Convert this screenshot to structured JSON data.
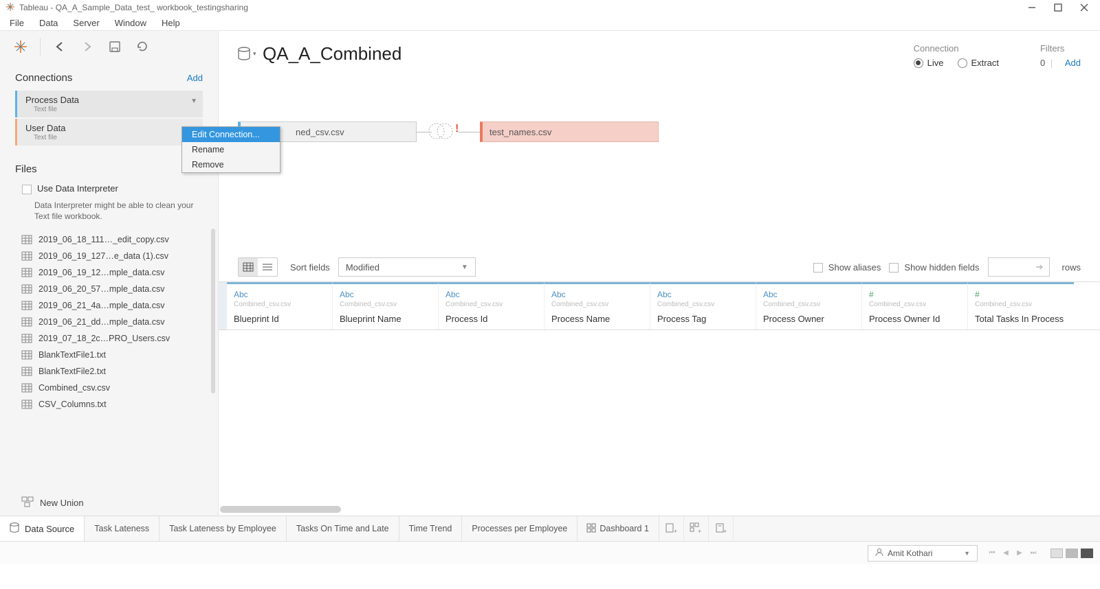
{
  "window": {
    "title": "Tableau - QA_A_Sample_Data_test_ workbook_testingsharing"
  },
  "menu": {
    "items": [
      "File",
      "Data",
      "Server",
      "Window",
      "Help"
    ]
  },
  "sidebar": {
    "connections_label": "Connections",
    "add_label": "Add",
    "connections": [
      {
        "name": "Process Data",
        "type": "Text file"
      },
      {
        "name": "User Data",
        "type": "Text file"
      }
    ],
    "files_label": "Files",
    "interpreter_label": "Use Data Interpreter",
    "interpreter_help": "Data Interpreter might be able to clean your Text file workbook.",
    "files": [
      "2019_06_18_111…_edit_copy.csv",
      "2019_06_19_127…e_data (1).csv",
      "2019_06_19_12…mple_data.csv",
      "2019_06_20_57…mple_data.csv",
      "2019_06_21_4a…mple_data.csv",
      "2019_06_21_dd…mple_data.csv",
      "2019_07_18_2c…PRO_Users.csv",
      "BlankTextFile1.txt",
      "BlankTextFile2.txt",
      "Combined_csv.csv",
      "CSV_Columns.txt"
    ],
    "new_union": "New Union"
  },
  "context_menu": {
    "items": [
      "Edit Connection...",
      "Rename",
      "Remove"
    ]
  },
  "datasource": {
    "title": "QA_A_Combined",
    "connection_label": "Connection",
    "live": "Live",
    "extract": "Extract",
    "filters_label": "Filters",
    "filters_count": "0",
    "filters_add": "Add"
  },
  "canvas": {
    "left_table": "ned_csv.csv",
    "right_table": "test_names.csv"
  },
  "grid": {
    "sort_label": "Sort fields",
    "sort_value": "Modified",
    "show_aliases": "Show aliases",
    "show_hidden": "Show hidden fields",
    "rows_label": "rows",
    "columns": [
      {
        "type": "Abc",
        "src": "Combined_csv.csv",
        "name": "Blueprint Id",
        "kind": "str"
      },
      {
        "type": "Abc",
        "src": "Combined_csv.csv",
        "name": "Blueprint Name",
        "kind": "str"
      },
      {
        "type": "Abc",
        "src": "Combined_csv.csv",
        "name": "Process Id",
        "kind": "str"
      },
      {
        "type": "Abc",
        "src": "Combined_csv.csv",
        "name": "Process Name",
        "kind": "str"
      },
      {
        "type": "Abc",
        "src": "Combined_csv.csv",
        "name": "Process Tag",
        "kind": "str"
      },
      {
        "type": "Abc",
        "src": "Combined_csv.csv",
        "name": "Process Owner",
        "kind": "str"
      },
      {
        "type": "#",
        "src": "Combined_csv.csv",
        "name": "Process Owner Id",
        "kind": "num"
      },
      {
        "type": "#",
        "src": "Combined_csv.csv",
        "name": "Total Tasks In Process",
        "kind": "num"
      }
    ]
  },
  "footer": {
    "data_source": "Data Source",
    "tabs": [
      "Task Lateness",
      "Task Lateness by Employee",
      "Tasks On Time and Late",
      "Time Trend",
      "Processes per Employee"
    ],
    "dashboard": "Dashboard 1"
  },
  "status": {
    "user": "Amit Kothari"
  }
}
